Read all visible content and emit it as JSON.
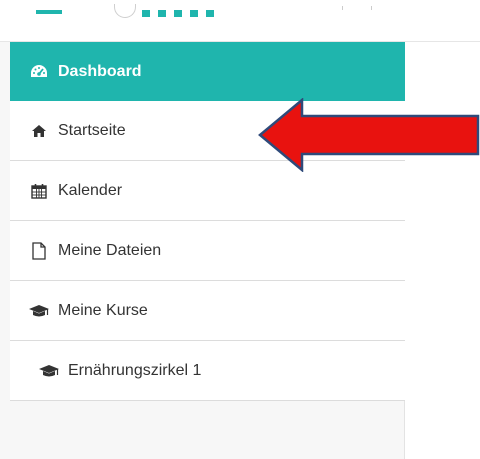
{
  "sidebar": {
    "items": [
      {
        "label": "Dashboard",
        "icon": "dashboard-gauge-icon",
        "active": true
      },
      {
        "label": "Startseite",
        "icon": "home-icon"
      },
      {
        "label": "Kalender",
        "icon": "calendar-icon"
      },
      {
        "label": "Meine Dateien",
        "icon": "file-icon"
      },
      {
        "label": "Meine Kurse",
        "icon": "graduation-cap-icon"
      },
      {
        "label": "Ernährungszirkel 1",
        "icon": "graduation-cap-icon"
      }
    ]
  },
  "colors": {
    "accent": "#1fb5ad",
    "arrow_fill": "#e8120f",
    "arrow_outline": "#2f4a7a"
  }
}
